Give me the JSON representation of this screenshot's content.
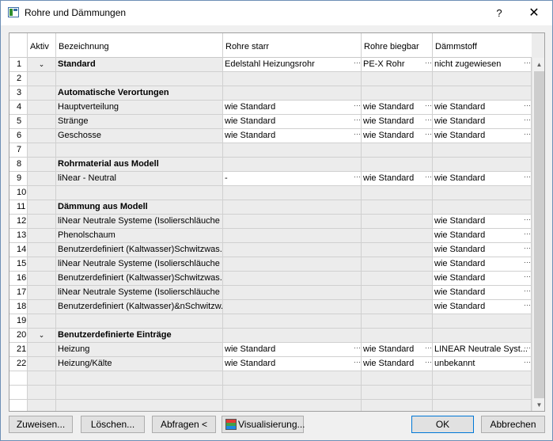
{
  "window": {
    "title": "Rohre und Dämmungen",
    "help": "?",
    "close": "✕",
    "icon": "app-window-icon"
  },
  "columns": {
    "num": "",
    "aktiv": "Aktiv",
    "bezeichnung": "Bezeichnung",
    "rohre_starr": "Rohre starr",
    "rohre_biegbar": "Rohre biegbar",
    "daemmstoff": "Dämmstoff"
  },
  "rows": [
    {
      "num": "1",
      "chevron": "⌄",
      "bez": "Standard",
      "bold": true,
      "rs": "Edelstahl Heizungsrohr",
      "rb": "PE-X Rohr",
      "dm": "nicht zugewiesen",
      "edit": [
        1,
        1,
        1
      ]
    },
    {
      "num": "2",
      "chevron": "",
      "bez": "",
      "bold": false,
      "rs": "",
      "rb": "",
      "dm": "",
      "edit": [
        0,
        0,
        0
      ]
    },
    {
      "num": "3",
      "chevron": "",
      "bez": "Automatische Verortungen",
      "bold": true,
      "rs": "",
      "rb": "",
      "dm": "",
      "edit": [
        0,
        0,
        0
      ]
    },
    {
      "num": "4",
      "chevron": "",
      "bez": "Hauptverteilung",
      "bold": false,
      "rs": "wie Standard",
      "rb": "wie Standard",
      "dm": "wie Standard",
      "edit": [
        1,
        1,
        1
      ]
    },
    {
      "num": "5",
      "chevron": "",
      "bez": "Stränge",
      "bold": false,
      "rs": "wie Standard",
      "rb": "wie Standard",
      "dm": "wie Standard",
      "edit": [
        1,
        1,
        1
      ]
    },
    {
      "num": "6",
      "chevron": "",
      "bez": "Geschosse",
      "bold": false,
      "rs": "wie Standard",
      "rb": "wie Standard",
      "dm": "wie Standard",
      "edit": [
        1,
        1,
        1
      ]
    },
    {
      "num": "7",
      "chevron": "",
      "bez": "",
      "bold": false,
      "rs": "",
      "rb": "",
      "dm": "",
      "edit": [
        0,
        0,
        0
      ]
    },
    {
      "num": "8",
      "chevron": "",
      "bez": "Rohrmaterial aus Modell",
      "bold": true,
      "rs": "",
      "rb": "",
      "dm": "",
      "edit": [
        0,
        0,
        0
      ]
    },
    {
      "num": "9",
      "chevron": "",
      "bez": "liNear - Neutral",
      "bold": false,
      "rs": "-",
      "rb": "wie Standard",
      "dm": "wie Standard",
      "edit": [
        1,
        1,
        1
      ]
    },
    {
      "num": "10",
      "chevron": "",
      "bez": "",
      "bold": false,
      "rs": "",
      "rb": "",
      "dm": "",
      "edit": [
        0,
        0,
        0
      ]
    },
    {
      "num": "11",
      "chevron": "",
      "bez": "Dämmung aus Modell",
      "bold": true,
      "rs": "",
      "rb": "",
      "dm": "",
      "edit": [
        0,
        0,
        0
      ]
    },
    {
      "num": "12",
      "chevron": "",
      "bez": "liNear Neutrale Systeme (Isolierschläuche ...",
      "bold": false,
      "rs": "",
      "rb": "",
      "dm": "wie Standard",
      "edit": [
        0,
        0,
        1
      ]
    },
    {
      "num": "13",
      "chevron": "",
      "bez": "Phenolschaum",
      "bold": false,
      "rs": "",
      "rb": "",
      "dm": "wie Standard",
      "edit": [
        0,
        0,
        1
      ]
    },
    {
      "num": "14",
      "chevron": "",
      "bez": "Benutzerdefiniert (Kaltwasser)Schwitzwas...",
      "bold": false,
      "rs": "",
      "rb": "",
      "dm": "wie Standard",
      "edit": [
        0,
        0,
        1
      ]
    },
    {
      "num": "15",
      "chevron": "",
      "bez": "liNear Neutrale Systeme (Isolierschläuche ...",
      "bold": false,
      "rs": "",
      "rb": "",
      "dm": "wie Standard",
      "edit": [
        0,
        0,
        1
      ]
    },
    {
      "num": "16",
      "chevron": "",
      "bez": "Benutzerdefiniert (Kaltwasser)Schwitzwas...",
      "bold": false,
      "rs": "",
      "rb": "",
      "dm": "wie Standard",
      "edit": [
        0,
        0,
        1
      ]
    },
    {
      "num": "17",
      "chevron": "",
      "bez": "liNear Neutrale Systeme (Isolierschläuche ...",
      "bold": false,
      "rs": "",
      "rb": "",
      "dm": "wie Standard",
      "edit": [
        0,
        0,
        1
      ]
    },
    {
      "num": "18",
      "chevron": "",
      "bez": "Benutzerdefiniert (Kaltwasser)&nSchwitzw...",
      "bold": false,
      "rs": "",
      "rb": "",
      "dm": "wie Standard",
      "edit": [
        0,
        0,
        1
      ]
    },
    {
      "num": "19",
      "chevron": "",
      "bez": "",
      "bold": false,
      "rs": "",
      "rb": "",
      "dm": "",
      "edit": [
        0,
        0,
        0
      ]
    },
    {
      "num": "20",
      "chevron": "⌄",
      "bez": "Benutzerdefinierte Einträge",
      "bold": true,
      "rs": "",
      "rb": "",
      "dm": "",
      "edit": [
        0,
        0,
        0
      ]
    },
    {
      "num": "21",
      "chevron": "",
      "bez": "Heizung",
      "bold": false,
      "rs": "wie Standard",
      "rb": "wie Standard",
      "dm": "LINEAR Neutrale Syst...",
      "edit": [
        1,
        1,
        1
      ]
    },
    {
      "num": "22",
      "chevron": "",
      "bez": "Heizung/Kälte",
      "bold": false,
      "rs": "wie Standard",
      "rb": "wie Standard",
      "dm": "unbekannt",
      "edit": [
        1,
        1,
        1
      ]
    }
  ],
  "empty_rows": 3,
  "ellipsis": "···",
  "buttons": {
    "zuweisen": "Zuweisen...",
    "loeschen": "Löschen...",
    "abfragen": "Abfragen <",
    "visualisierung": "Visualisierung...",
    "ok": "OK",
    "abbrechen": "Abbrechen"
  },
  "scrollbar": {
    "up": "▲",
    "down": "▼"
  }
}
